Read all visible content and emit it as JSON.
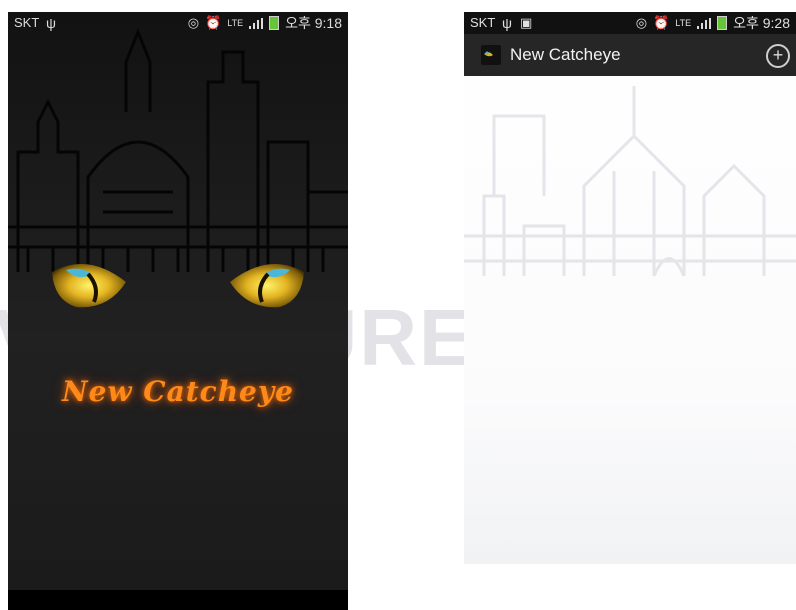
{
  "splash": {
    "status_bar": {
      "carrier": "SKT",
      "usb_icon": "usb-icon",
      "time": "오후 9:18"
    },
    "app_title": "New Catcheye"
  },
  "app": {
    "status_bar": {
      "carrier": "SKT",
      "usb_icon": "usb-icon",
      "image_icon": "image-icon",
      "time": "오후 9:28"
    },
    "action_bar": {
      "title": "New Catcheye",
      "add_icon": "add-circle-icon"
    }
  },
  "watermark": {
    "text": "VE SECURE YOUR LIFE"
  },
  "colors": {
    "accent_orange": "#ff8a1a",
    "dark_bg": "#1b1b1b",
    "action_bar": "#262626",
    "battery": "#69c23b"
  }
}
